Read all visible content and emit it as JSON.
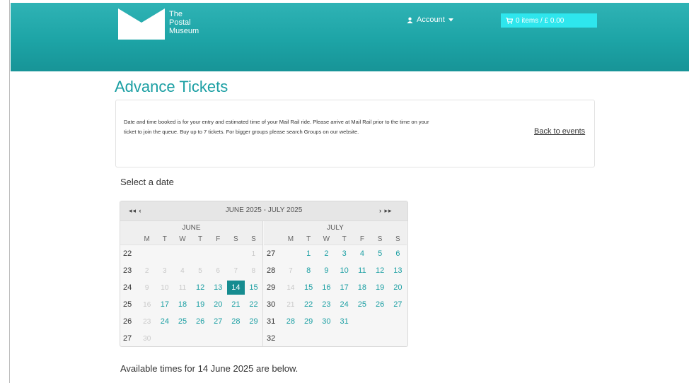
{
  "header": {
    "logo_lines": [
      "The",
      "Postal",
      "Museum"
    ],
    "account_label": "Account",
    "cart_label": "0 items / £ 0.00"
  },
  "page_title": "Advance Tickets",
  "info": {
    "text": "Date and time booked is for your entry and estimated time of your Mail Rail ride. Please arrive at Mail Rail prior to the time on your ticket to join the queue. Buy up to 7 tickets. For bigger groups please search Groups on our website.",
    "back_link": "Back to events"
  },
  "select_date_label": "Select a date",
  "calendar": {
    "prev_label": "◂◂ ‹",
    "next_label": "› ▸▸",
    "range_title": "JUNE 2025 - JULY 2025",
    "weekday_labels": [
      "M",
      "T",
      "W",
      "T",
      "F",
      "S",
      "S"
    ],
    "selected_date": "14",
    "months": [
      {
        "name": "JUNE",
        "weeks": [
          {
            "num": "22",
            "days": [
              {
                "d": "",
                "s": "blank"
              },
              {
                "d": "",
                "s": "blank"
              },
              {
                "d": "",
                "s": "blank"
              },
              {
                "d": "",
                "s": "blank"
              },
              {
                "d": "",
                "s": "blank"
              },
              {
                "d": "",
                "s": "blank"
              },
              {
                "d": "1",
                "s": "muted"
              }
            ]
          },
          {
            "num": "23",
            "days": [
              {
                "d": "2",
                "s": "muted"
              },
              {
                "d": "3",
                "s": "muted"
              },
              {
                "d": "4",
                "s": "muted"
              },
              {
                "d": "5",
                "s": "muted"
              },
              {
                "d": "6",
                "s": "muted"
              },
              {
                "d": "7",
                "s": "muted"
              },
              {
                "d": "8",
                "s": "muted"
              }
            ]
          },
          {
            "num": "24",
            "days": [
              {
                "d": "9",
                "s": "muted"
              },
              {
                "d": "10",
                "s": "muted"
              },
              {
                "d": "11",
                "s": "muted"
              },
              {
                "d": "12",
                "s": "avail"
              },
              {
                "d": "13",
                "s": "avail"
              },
              {
                "d": "14",
                "s": "selected"
              },
              {
                "d": "15",
                "s": "avail"
              }
            ]
          },
          {
            "num": "25",
            "days": [
              {
                "d": "16",
                "s": "muted"
              },
              {
                "d": "17",
                "s": "avail"
              },
              {
                "d": "18",
                "s": "avail"
              },
              {
                "d": "19",
                "s": "avail"
              },
              {
                "d": "20",
                "s": "avail"
              },
              {
                "d": "21",
                "s": "avail"
              },
              {
                "d": "22",
                "s": "avail"
              }
            ]
          },
          {
            "num": "26",
            "days": [
              {
                "d": "23",
                "s": "muted"
              },
              {
                "d": "24",
                "s": "avail"
              },
              {
                "d": "25",
                "s": "avail"
              },
              {
                "d": "26",
                "s": "avail"
              },
              {
                "d": "27",
                "s": "avail"
              },
              {
                "d": "28",
                "s": "avail"
              },
              {
                "d": "29",
                "s": "avail"
              }
            ]
          },
          {
            "num": "27",
            "days": [
              {
                "d": "30",
                "s": "muted"
              },
              {
                "d": "",
                "s": "blank"
              },
              {
                "d": "",
                "s": "blank"
              },
              {
                "d": "",
                "s": "blank"
              },
              {
                "d": "",
                "s": "blank"
              },
              {
                "d": "",
                "s": "blank"
              },
              {
                "d": "",
                "s": "blank"
              }
            ]
          }
        ]
      },
      {
        "name": "JULY",
        "weeks": [
          {
            "num": "27",
            "days": [
              {
                "d": "",
                "s": "blank"
              },
              {
                "d": "1",
                "s": "avail"
              },
              {
                "d": "2",
                "s": "avail"
              },
              {
                "d": "3",
                "s": "avail"
              },
              {
                "d": "4",
                "s": "avail"
              },
              {
                "d": "5",
                "s": "avail"
              },
              {
                "d": "6",
                "s": "avail"
              }
            ]
          },
          {
            "num": "28",
            "days": [
              {
                "d": "7",
                "s": "muted"
              },
              {
                "d": "8",
                "s": "avail"
              },
              {
                "d": "9",
                "s": "avail"
              },
              {
                "d": "10",
                "s": "avail"
              },
              {
                "d": "11",
                "s": "avail"
              },
              {
                "d": "12",
                "s": "avail"
              },
              {
                "d": "13",
                "s": "avail"
              }
            ]
          },
          {
            "num": "29",
            "days": [
              {
                "d": "14",
                "s": "muted"
              },
              {
                "d": "15",
                "s": "avail"
              },
              {
                "d": "16",
                "s": "avail"
              },
              {
                "d": "17",
                "s": "avail"
              },
              {
                "d": "18",
                "s": "avail"
              },
              {
                "d": "19",
                "s": "avail"
              },
              {
                "d": "20",
                "s": "avail"
              }
            ]
          },
          {
            "num": "30",
            "days": [
              {
                "d": "21",
                "s": "muted"
              },
              {
                "d": "22",
                "s": "avail"
              },
              {
                "d": "23",
                "s": "avail"
              },
              {
                "d": "24",
                "s": "avail"
              },
              {
                "d": "25",
                "s": "avail"
              },
              {
                "d": "26",
                "s": "avail"
              },
              {
                "d": "27",
                "s": "avail"
              }
            ]
          },
          {
            "num": "31",
            "days": [
              {
                "d": "28",
                "s": "avail"
              },
              {
                "d": "29",
                "s": "avail"
              },
              {
                "d": "30",
                "s": "avail"
              },
              {
                "d": "31",
                "s": "avail"
              },
              {
                "d": "",
                "s": "blank"
              },
              {
                "d": "",
                "s": "blank"
              },
              {
                "d": "",
                "s": "blank"
              }
            ]
          },
          {
            "num": "32",
            "days": [
              {
                "d": "",
                "s": "blank"
              },
              {
                "d": "",
                "s": "blank"
              },
              {
                "d": "",
                "s": "blank"
              },
              {
                "d": "",
                "s": "blank"
              },
              {
                "d": "",
                "s": "blank"
              },
              {
                "d": "",
                "s": "blank"
              },
              {
                "d": "",
                "s": "blank"
              }
            ]
          }
        ]
      }
    ]
  },
  "available_times_text": "Available times for 14 June 2025 are below.",
  "colors": {
    "brand_teal": "#1b9fa3",
    "header_teal": "#1da4a6",
    "cart_cyan": "#2ee6ed",
    "selected_day": "#168c90"
  },
  "icons": {
    "account": "user-icon",
    "account_caret": "caret-down-icon",
    "cart": "shopping-cart-icon",
    "logo": "envelope-logo-icon"
  }
}
